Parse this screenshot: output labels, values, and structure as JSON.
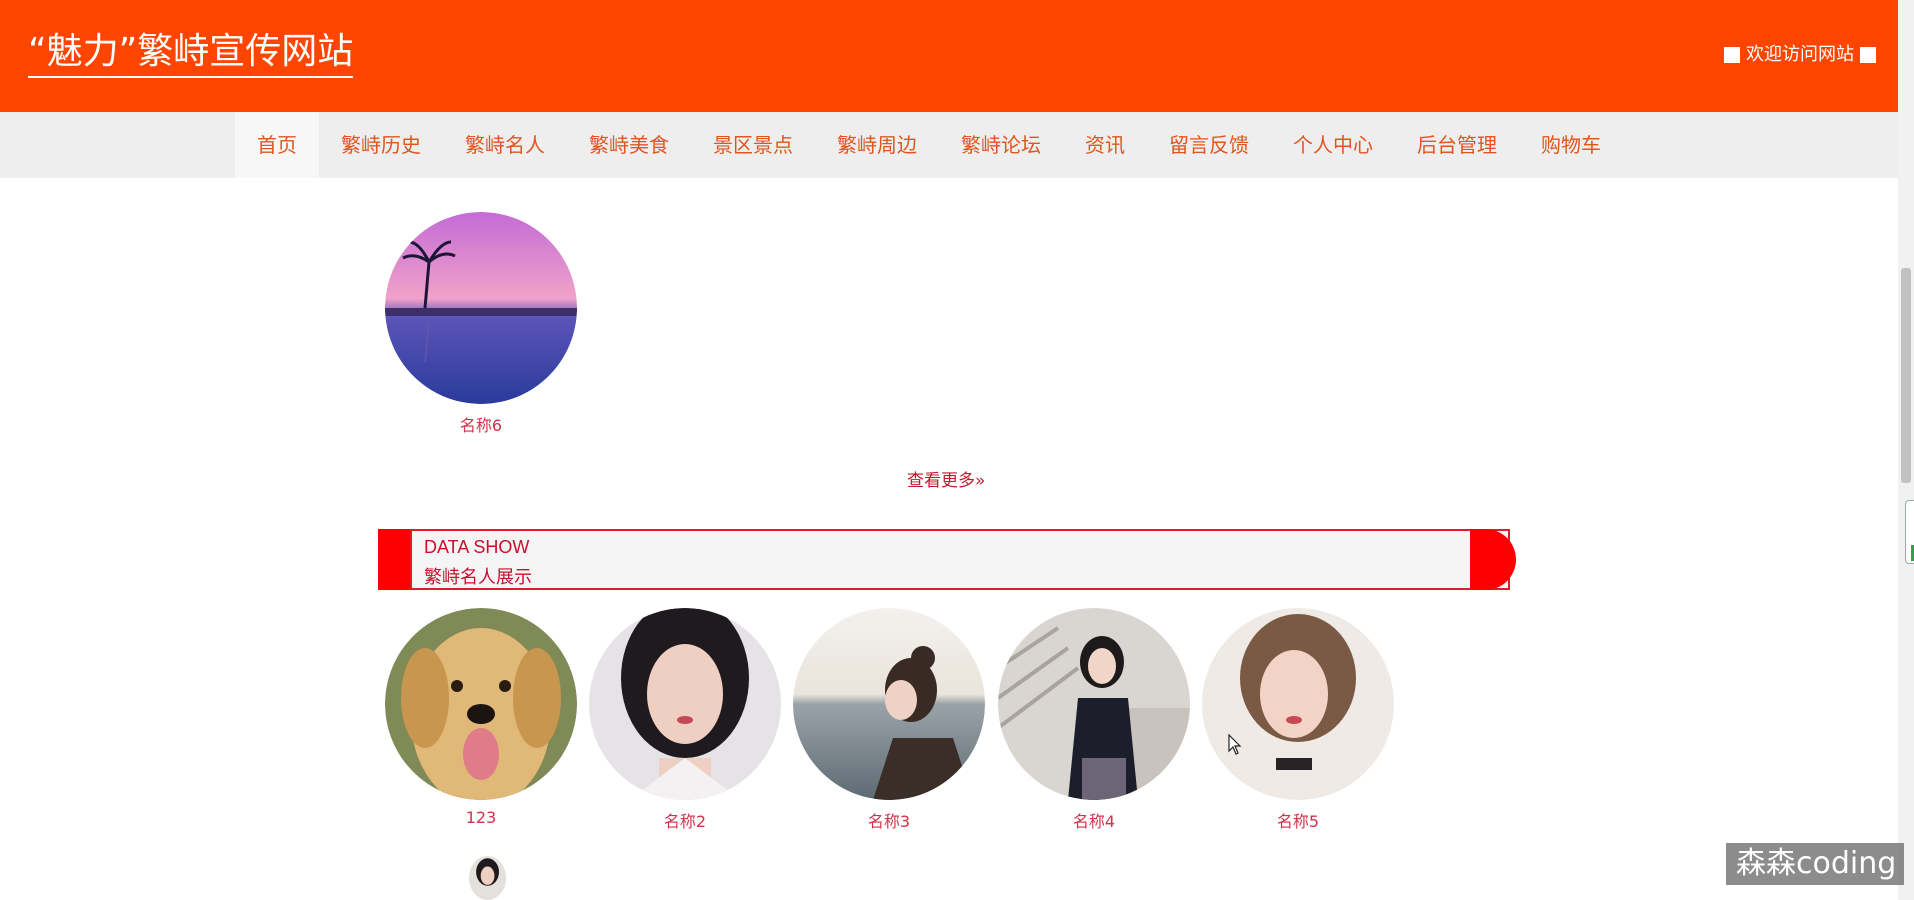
{
  "header": {
    "site_title": "“魅力”繁峙宣传网站",
    "welcome_text": "欢迎访问网站",
    "bg_color": "#ff4500"
  },
  "nav": {
    "items": [
      "首页",
      "繁峙历史",
      "繁峙名人",
      "繁峙美食",
      "景区景点",
      "繁峙周边",
      "繁峙论坛",
      "资讯",
      "留言反馈",
      "个人中心",
      "后台管理",
      "购物车"
    ],
    "active_index": 0,
    "text_color": "#e0561e"
  },
  "scenic_section": {
    "items": [
      {
        "label": "名称6",
        "image": "sunset-palm-beach-photo"
      }
    ],
    "more_link": "查看更多"
  },
  "celebrity_section": {
    "header_en": "DATA SHOW",
    "header_cn": "繁峙名人展示",
    "accent_color": "#ff0000",
    "items": [
      {
        "label": "123",
        "image": "golden-retriever-photo"
      },
      {
        "label": "名称2",
        "image": "woman-portrait-photo"
      },
      {
        "label": "名称3",
        "image": "woman-by-sea-photo"
      },
      {
        "label": "名称4",
        "image": "girl-on-stairs-photo"
      },
      {
        "label": "名称5",
        "image": "woman-short-hair-photo"
      }
    ]
  },
  "watermark": "森森coding"
}
